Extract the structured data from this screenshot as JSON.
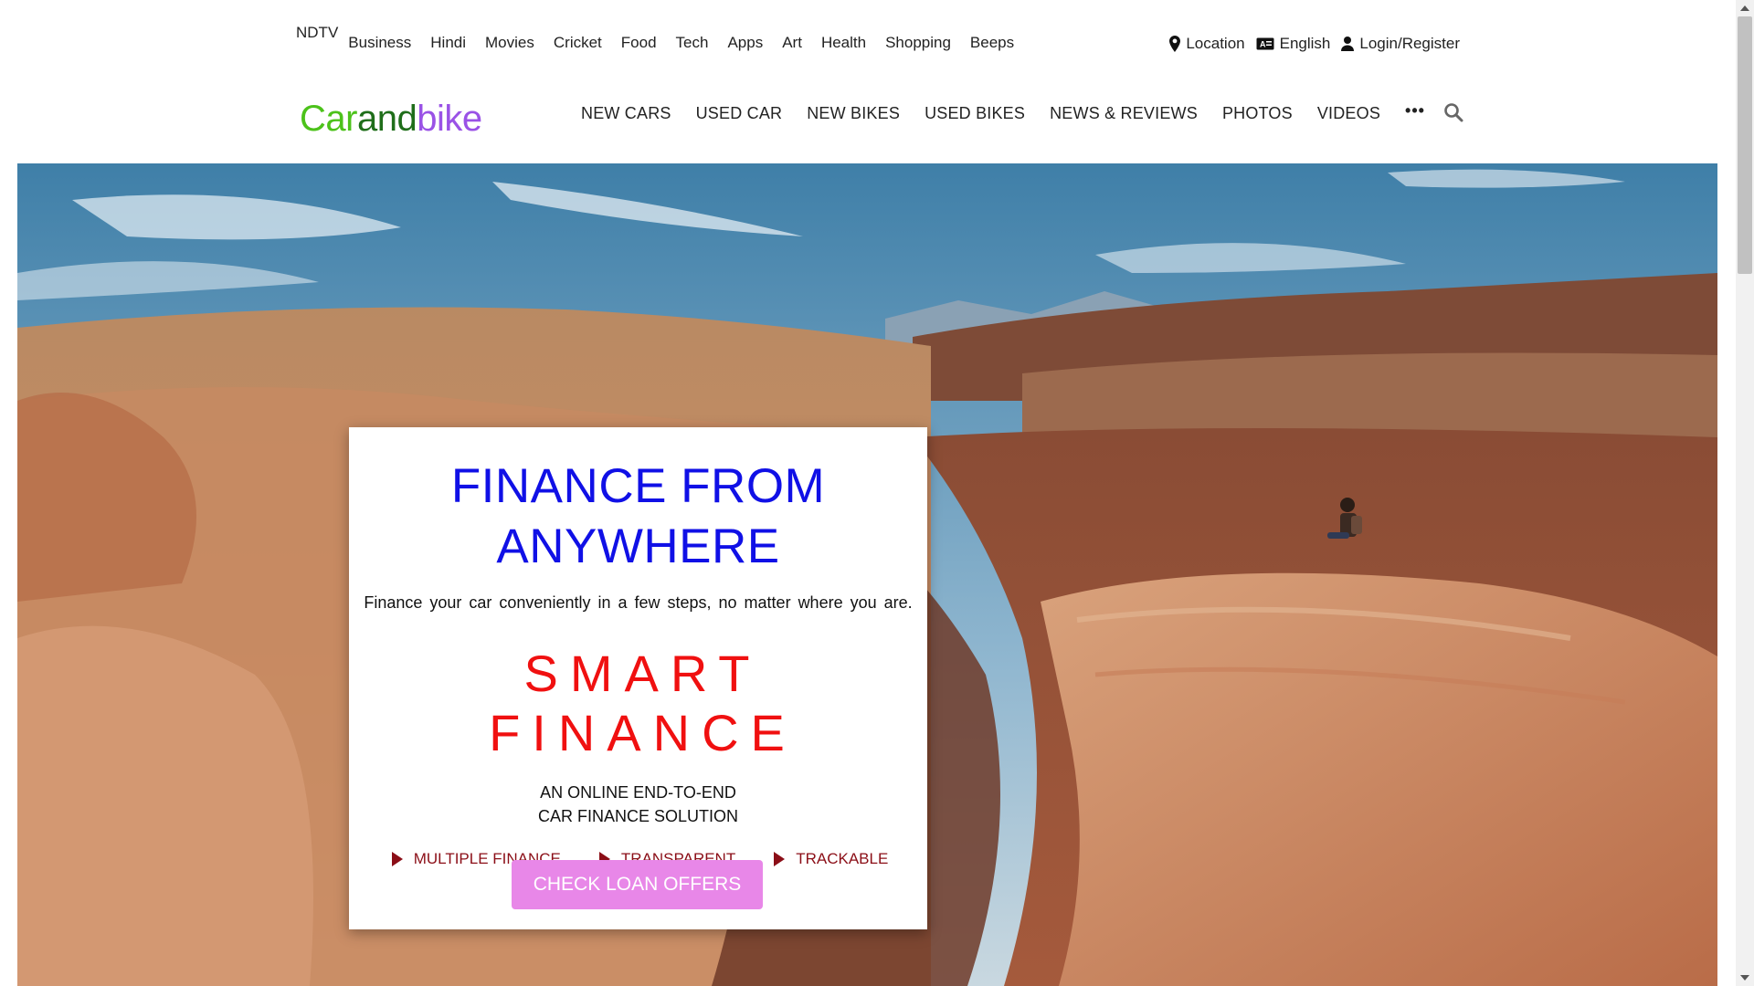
{
  "topbar": {
    "brand": "NDTV",
    "links": [
      "Business",
      "Hindi",
      "Movies",
      "Cricket",
      "Food",
      "Tech",
      "Apps",
      "Art",
      "Health",
      "Shopping",
      "Beeps"
    ]
  },
  "utility": {
    "location": "Location",
    "language": "English",
    "login": "Login/Register"
  },
  "logo": {
    "part1": "Car",
    "part2": "and",
    "part3": "bike"
  },
  "mainnav": {
    "items": [
      "NEW CARS",
      "USED CAR",
      "NEW BIKES",
      "USED BIKES",
      "NEWS & REVIEWS",
      "PHOTOS",
      "VIDEOS"
    ],
    "more": "•••"
  },
  "card": {
    "headline_line1": "FINANCE FROM",
    "headline_line2": "ANYWHERE",
    "subtitle": "Finance your car conveniently in a few steps, no matter where you are.",
    "brand": "SMART FINANCE",
    "solution_line1": "AN ONLINE END-TO-END",
    "solution_line2": "CAR FINANCE SOLUTION",
    "features": [
      "MULTIPLE FINANCE",
      "TRANSPARENT",
      "TRACKABLE"
    ],
    "cta": "CHECK LOAN OFFERS"
  },
  "colors": {
    "headline": "#1010e6",
    "brand_red": "#f01010",
    "feature": "#8b0e17",
    "cta_bg": "#e887e8",
    "logo_green": "#4cc21a",
    "logo_dark": "#1f6e1a",
    "logo_purple": "#9a52e6"
  },
  "icons": {
    "location": "map-pin-icon",
    "language": "language-icon",
    "login": "user-icon",
    "search": "search-icon"
  }
}
